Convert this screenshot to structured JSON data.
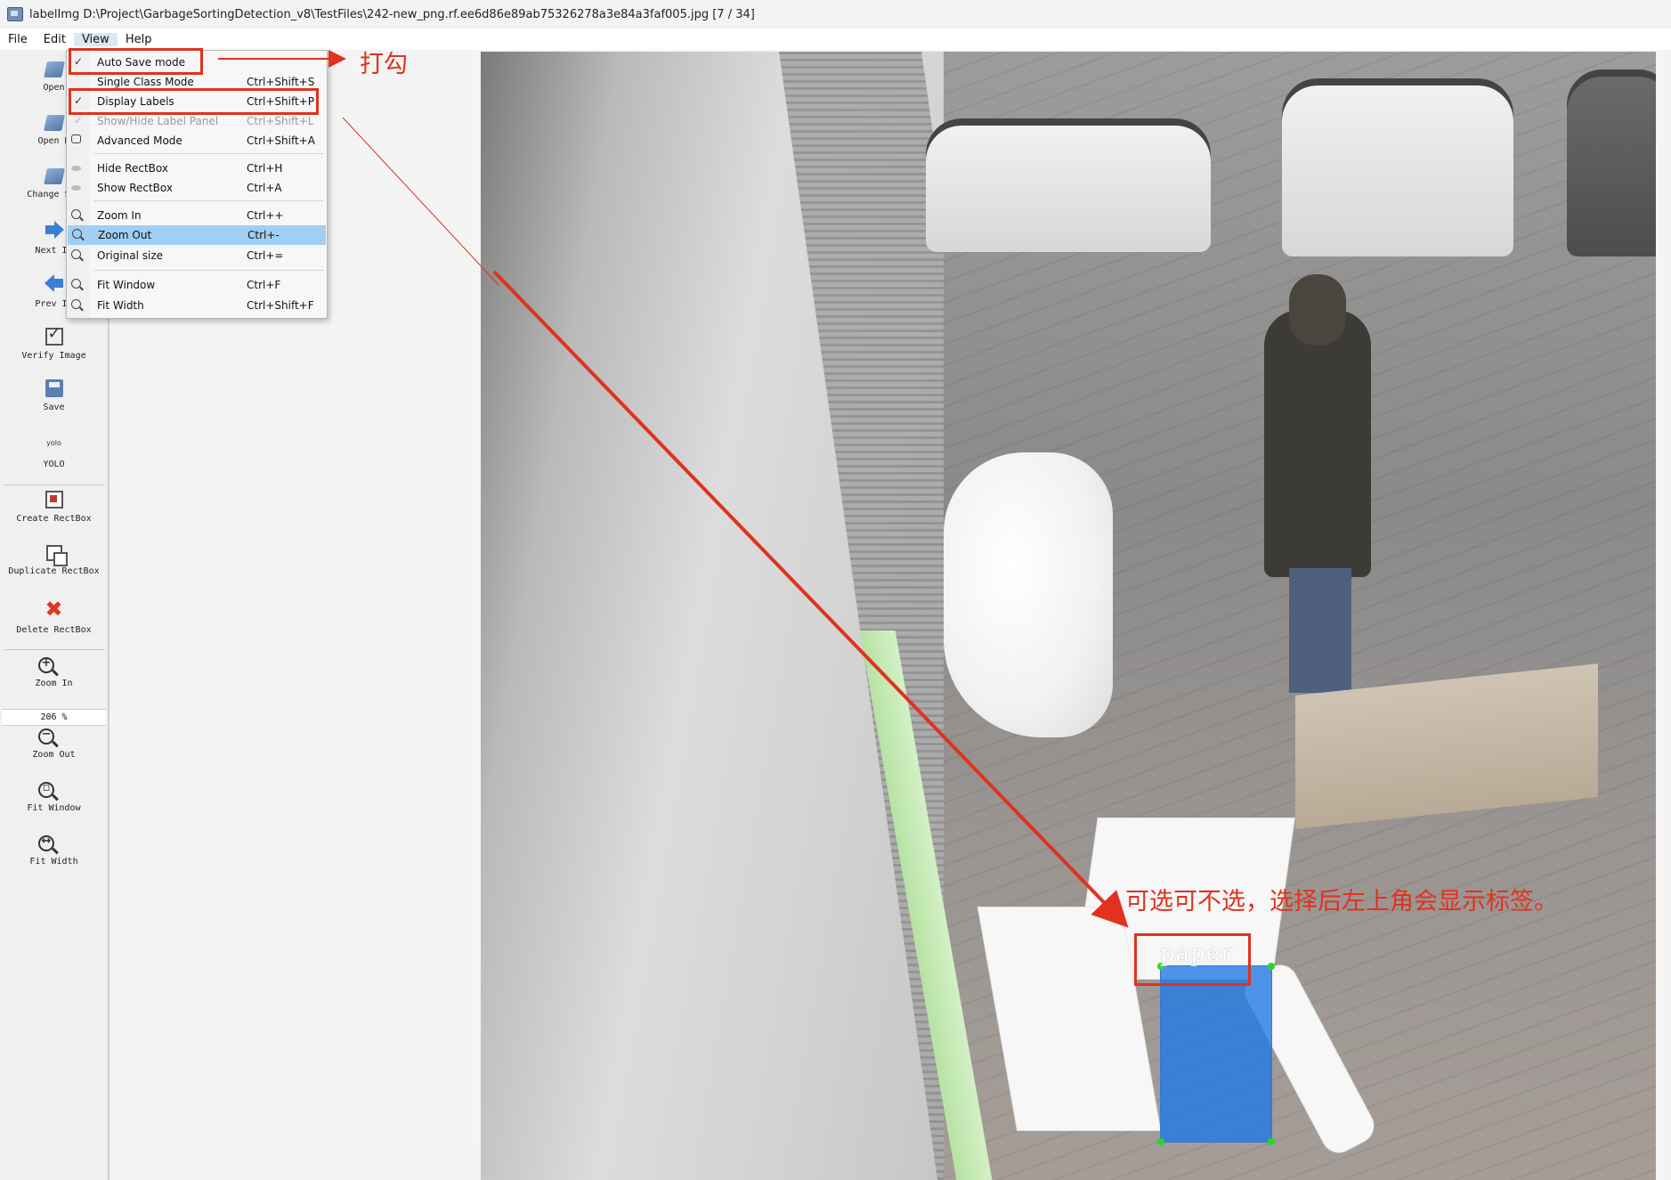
{
  "window": {
    "title": "labelImg D:\\Project\\GarbageSortingDetection_v8\\TestFiles\\242-new_png.rf.ee6d86e89ab75326278a3e84a3faf005.jpg [7 / 34]"
  },
  "menubar": {
    "items": [
      {
        "label": "File"
      },
      {
        "label": "Edit"
      },
      {
        "label": "View"
      },
      {
        "label": "Help"
      }
    ]
  },
  "toolbar": {
    "items": [
      {
        "label": "Open",
        "icon": "folder-icon"
      },
      {
        "label": "Open D",
        "icon": "folder-icon"
      },
      {
        "label": "Change Sav",
        "icon": "folder-icon"
      },
      {
        "label": "Next In",
        "icon": "arrow-right-icon"
      },
      {
        "label": "Prev In",
        "icon": "arrow-left-icon"
      },
      {
        "label": "Verify Image",
        "icon": "check-icon"
      },
      {
        "label": "Save",
        "icon": "save-icon"
      },
      {
        "label": "YOLO",
        "icon": "yolo-icon",
        "icon_text": "yolo"
      },
      {
        "label": "Create RectBox",
        "icon": "rectbox-icon"
      },
      {
        "label": "Duplicate RectBox",
        "icon": "duplicate-icon"
      },
      {
        "label": "Delete RectBox",
        "icon": "delete-icon"
      },
      {
        "label": "Zoom In",
        "icon": "zoom-in-icon"
      },
      {
        "label": "Zoom Out",
        "icon": "zoom-out-icon"
      },
      {
        "label": "Fit Window",
        "icon": "fit-window-icon"
      },
      {
        "label": "Fit Width",
        "icon": "fit-width-icon"
      }
    ],
    "zoom_value": "206 %"
  },
  "view_menu": {
    "items": [
      {
        "label": "Auto Save mode",
        "shortcut": "",
        "checked": true,
        "enabled": true
      },
      {
        "label": "Single Class Mode",
        "shortcut": "Ctrl+Shift+S",
        "checked": false,
        "enabled": true
      },
      {
        "label": "Display Labels",
        "shortcut": "Ctrl+Shift+P",
        "checked": true,
        "enabled": true
      },
      {
        "label": "Show/Hide Label Panel",
        "shortcut": "Ctrl+Shift+L",
        "checked": true,
        "enabled": false
      },
      {
        "label": "Advanced Mode",
        "shortcut": "Ctrl+Shift+A",
        "checked": false,
        "enabled": true,
        "icon": "advanced-mode-icon"
      },
      {
        "label": "Hide RectBox",
        "shortcut": "Ctrl+H",
        "icon": "eye-icon"
      },
      {
        "label": "Show RectBox",
        "shortcut": "Ctrl+A",
        "icon": "eye-icon"
      },
      {
        "label": "Zoom In",
        "shortcut": "Ctrl++",
        "icon": "zoom-in-icon"
      },
      {
        "label": "Zoom Out",
        "shortcut": "Ctrl+-",
        "icon": "zoom-out-icon",
        "highlighted": true
      },
      {
        "label": "Original size",
        "shortcut": "Ctrl+=",
        "icon": "zoom-icon"
      },
      {
        "label": "Fit Window",
        "shortcut": "Ctrl+F",
        "icon": "fit-window-icon"
      },
      {
        "label": "Fit Width",
        "shortcut": "Ctrl+Shift+F",
        "icon": "fit-width-icon"
      }
    ]
  },
  "canvas": {
    "bbox_label": "paper"
  },
  "annotations": {
    "check_note": "打勾",
    "optional_note": "可选可不选，选择后左上角会显示标签。",
    "color": "#e0321f"
  },
  "colors": {
    "bbox_fill": "#1e78e6",
    "menu_highlight": "#9fcff4",
    "annotation_red": "#e0321f"
  }
}
